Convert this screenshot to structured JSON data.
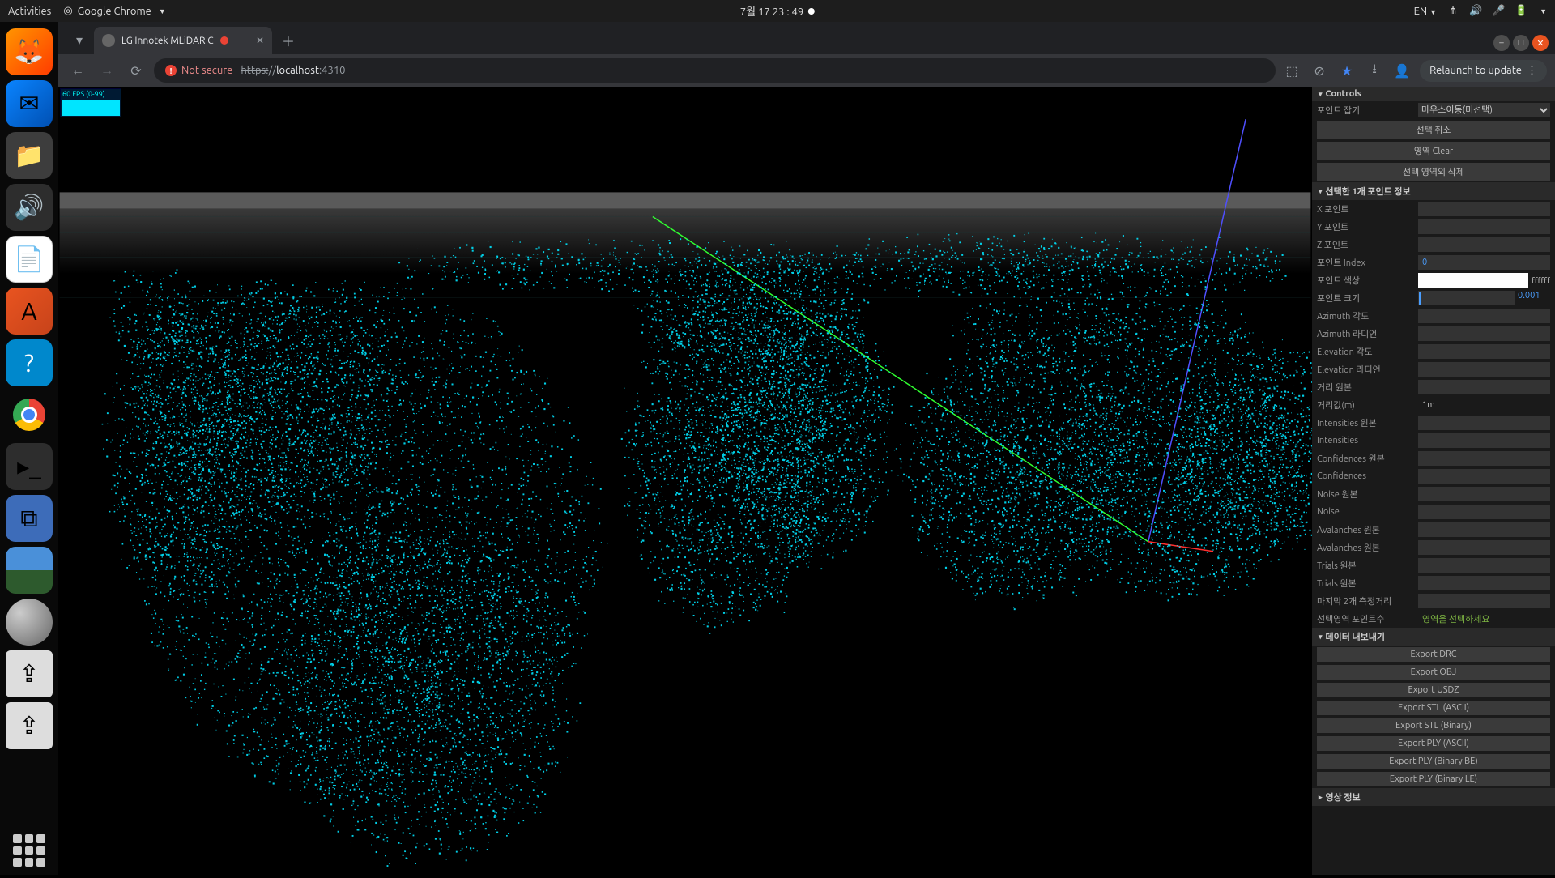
{
  "topbar": {
    "activities": "Activities",
    "app": "Google Chrome",
    "datetime": "7월 17  23 : 49",
    "lang": "EN"
  },
  "tab": {
    "title": "LG Innotek MLiDAR C"
  },
  "addr": {
    "not_secure": "Not secure",
    "protocol": "https:",
    "sep": "//",
    "host": "localhost",
    "port": ":4310"
  },
  "relaunch": "Relaunch to update",
  "fps": "60 FPS (0-99)",
  "panel": {
    "controls": "Controls",
    "pick_label": "포인트 잡기",
    "pick_mode": "마우스이동(미선택)",
    "btn_cancel": "선택 취소",
    "btn_clear": "영역 Clear",
    "btn_delete": "선택 영역외 삭제",
    "section_point": "선택한 1개 포인트 정보",
    "x": "X 포인트",
    "y": "Y 포인트",
    "z": "Z 포인트",
    "idx": "포인트 Index",
    "idx_val": "0",
    "color": "포인트 색상",
    "color_hex": "ffffff",
    "size": "포인트 크기",
    "size_val": "0.001",
    "az_deg": "Azimuth 각도",
    "az_rad": "Azimuth 라디언",
    "el_deg": "Elevation 각도",
    "el_rad": "Elevation 라디언",
    "dist_raw": "거리 원본",
    "dist_m": "거리값(m)",
    "dist_m_val": "1m",
    "int_raw": "Intensities 원본",
    "int": "Intensities",
    "conf_raw": "Confidences 원본",
    "conf": "Confidences",
    "noise_raw": "Noise 원본",
    "noise": "Noise",
    "ava_raw": "Avalanches 원본",
    "ava_raw2": "Avalanches 원본",
    "trials_raw": "Trials 원본",
    "trials_raw2": "Trials 원본",
    "last2": "마지막 2개 측정거리",
    "sel_count": "선택영역 포인트수",
    "sel_msg": "영역을 선택하세요",
    "section_export": "데이터 내보내기",
    "exp_drc": "Export DRC",
    "exp_obj": "Export OBJ",
    "exp_usdz": "Export USDZ",
    "exp_stl_a": "Export STL (ASCII)",
    "exp_stl_b": "Export STL (Binary)",
    "exp_ply_a": "Export PLY (ASCII)",
    "exp_ply_be": "Export PLY (Binary BE)",
    "exp_ply_le": "Export PLY (Binary LE)",
    "section_video": "영상 정보"
  }
}
